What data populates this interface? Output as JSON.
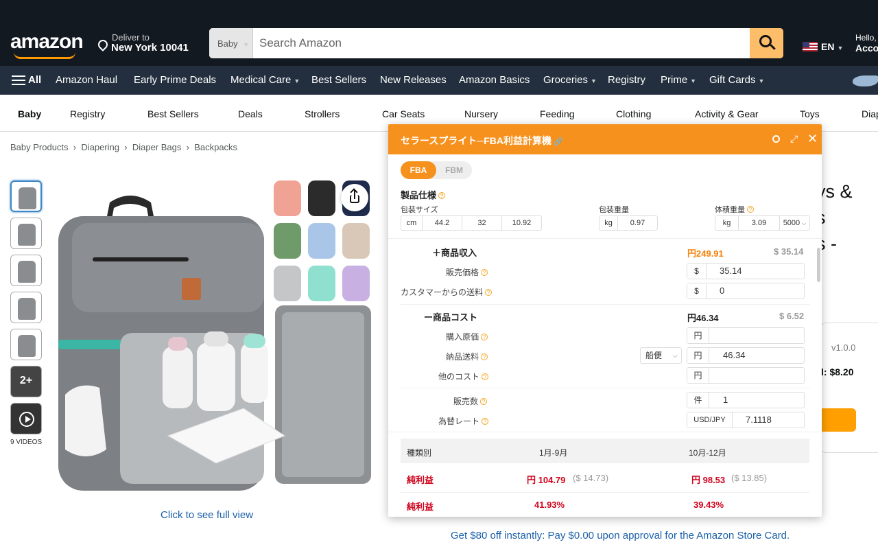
{
  "header": {
    "deliver_line1": "Deliver to",
    "deliver_line2": "New York 10041",
    "search_category": "Baby",
    "search_placeholder": "Search Amazon",
    "lang": "EN",
    "hello": "Hello,",
    "account": "Acco"
  },
  "nav": {
    "all": "All",
    "items": [
      "Amazon Haul",
      "Early Prime Deals",
      "Medical Care",
      "Best Sellers",
      "New Releases",
      "Amazon Basics",
      "Groceries",
      "Registry",
      "Prime",
      "Gift Cards"
    ]
  },
  "subnav": [
    "Baby",
    "Registry",
    "Best Sellers",
    "Deals",
    "Strollers",
    "Car Seats",
    "Nursery",
    "Feeding",
    "Clothing",
    "Activity & Gear",
    "Toys",
    "Diap"
  ],
  "breadcrumb": [
    "Baby Products",
    "Diapering",
    "Diaper Bags",
    "Backpacks"
  ],
  "gallery": {
    "more_count": "2+",
    "videos_label": "9 VIDEOS",
    "click_full_view": "Click to see full view"
  },
  "product": {
    "title_lines": [
      "ys &",
      "s",
      "s -"
    ],
    "version": "v1.0.0",
    "price_text": "l: $8.20",
    "promo": "Get $80 off instantly: Pay $0.00 upon approval for the Amazon Store Card."
  },
  "panel": {
    "title": "セラースプライト─FBA利益計算機",
    "link_icon": "🔗",
    "tab_fba": "FBA",
    "tab_fbm": "FBM",
    "spec_label": "製品仕様",
    "pack_size_label": "包装サイズ",
    "pack_weight_label": "包装重量",
    "vol_weight_label": "体積重量",
    "size_unit": "cm",
    "size_values": [
      "44.2",
      "32",
      "10.92"
    ],
    "weight_unit": "kg",
    "weight_value": "0.97",
    "vol_unit": "kg",
    "vol_value": "3.09",
    "vol_divisor": "5000",
    "income_label": "＋商品収入",
    "income_yen": "円249.91",
    "income_usd": "$ 35.14",
    "sale_price_label": "販売価格",
    "sale_price_prefix": "$",
    "sale_price_value": "35.14",
    "shipping_label": "カスタマーからの送料",
    "shipping_prefix": "$",
    "shipping_value": "0",
    "cost_label": "ー商品コスト",
    "cost_yen": "円46.34",
    "cost_usd": "$ 6.52",
    "purchase_label": "購入原価",
    "purchase_prefix": "円",
    "purchase_value": "",
    "inbound_label": "納品送料",
    "inbound_method": "船便",
    "inbound_prefix": "円",
    "inbound_value": "46.34",
    "other_label": "他のコスト",
    "other_prefix": "円",
    "other_value": "",
    "qty_label": "販売数",
    "qty_prefix": "件",
    "qty_value": "1",
    "fx_label": "為替レート",
    "fx_prefix": "USD/JPY",
    "fx_value": "7.1118",
    "result": {
      "col_type": "種類別",
      "col_p1": "1月-9月",
      "col_p2": "10月-12月",
      "rows": [
        {
          "label": "純利益",
          "p1": "円 104.79",
          "p1_usd": "($ 14.73)",
          "p2": "円 98.53",
          "p2_usd": "($ 13.85)"
        },
        {
          "label": "純利益",
          "p1": "41.93%",
          "p1_usd": "",
          "p2": "39.43%",
          "p2_usd": ""
        }
      ]
    }
  }
}
